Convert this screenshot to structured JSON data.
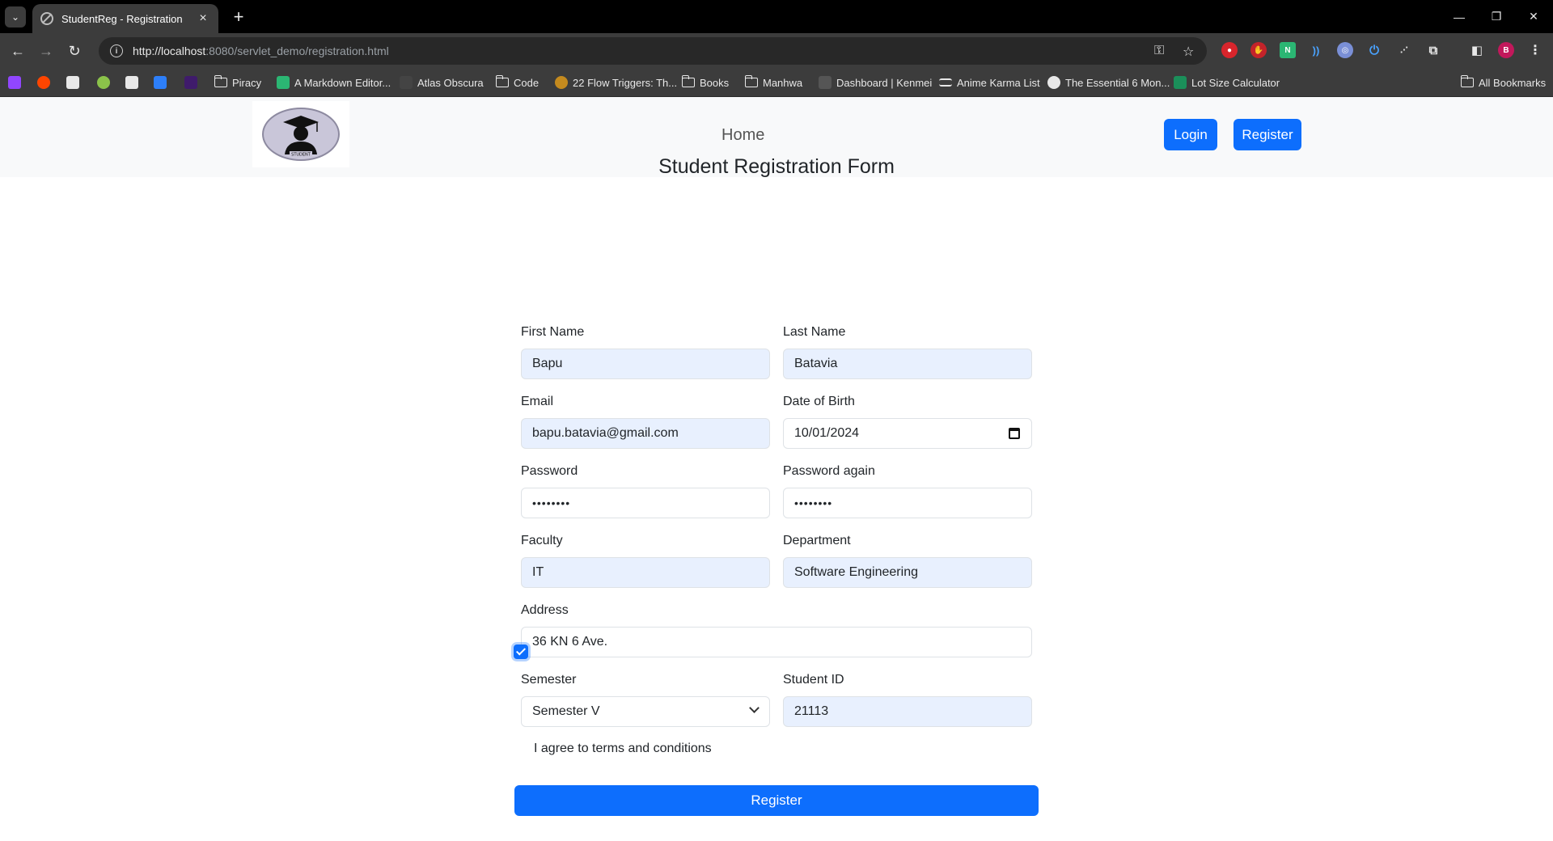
{
  "browser": {
    "tab_title": "StudentReg - Registration",
    "url_host": "http://localhost",
    "url_path": ":8080/servlet_demo/registration.html",
    "bookmarks": [
      {
        "label": "Piracy",
        "type": "folder"
      },
      {
        "label": "A Markdown Editor...",
        "type": "link"
      },
      {
        "label": "Atlas Obscura",
        "type": "link"
      },
      {
        "label": "Code",
        "type": "folder"
      },
      {
        "label": "22 Flow Triggers: Th...",
        "type": "link"
      },
      {
        "label": "Books",
        "type": "folder"
      },
      {
        "label": "Manhwa",
        "type": "folder"
      },
      {
        "label": "Dashboard | Kenmei",
        "type": "link"
      },
      {
        "label": "Anime Karma List",
        "type": "link"
      },
      {
        "label": "The Essential 6 Mon...",
        "type": "link"
      },
      {
        "label": "Lot Size Calculator",
        "type": "link"
      }
    ],
    "all_bookmarks": "All Bookmarks",
    "profile_initial": "B"
  },
  "navbar": {
    "logo_text": "STUDENT",
    "home": "Home",
    "login": "Login",
    "register": "Register"
  },
  "form": {
    "title": "Student Registration Form",
    "first_name": {
      "label": "First Name",
      "value": "Bapu"
    },
    "last_name": {
      "label": "Last Name",
      "value": "Batavia"
    },
    "email": {
      "label": "Email",
      "value": "bapu.batavia@gmail.com"
    },
    "dob": {
      "label": "Date of Birth",
      "value": "10/01/2024"
    },
    "password": {
      "label": "Password",
      "value": "••••••••"
    },
    "password_again": {
      "label": "Password again",
      "value": "••••••••"
    },
    "faculty": {
      "label": "Faculty",
      "value": "IT"
    },
    "department": {
      "label": "Department",
      "value": "Software Engineering"
    },
    "address": {
      "label": "Address",
      "value": "36 KN 6 Ave."
    },
    "semester": {
      "label": "Semester",
      "value": "Semester V"
    },
    "student_id": {
      "label": "Student ID",
      "value": "21113"
    },
    "terms": "I agree to terms and conditions",
    "submit": "Register"
  },
  "colors": {
    "primary": "#0d6efd",
    "autofill": "#e8f0fe"
  }
}
